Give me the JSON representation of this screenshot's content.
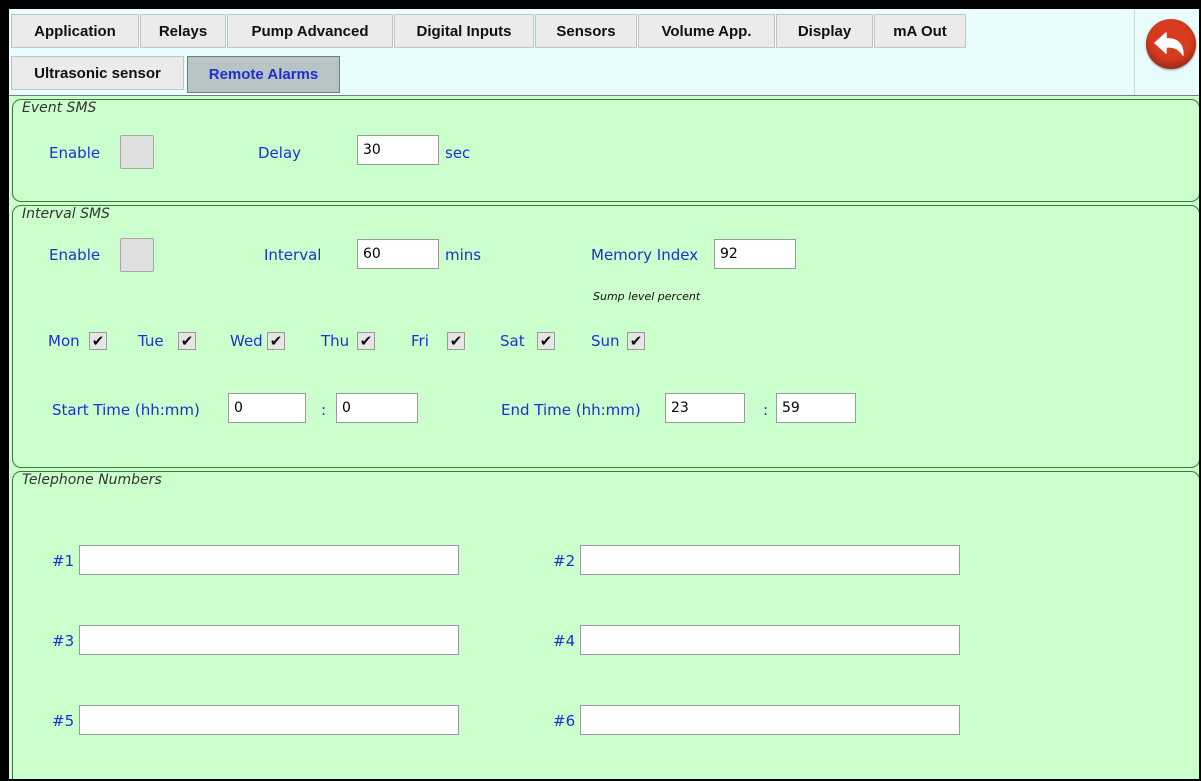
{
  "tabs": {
    "row1": [
      "Application",
      "Relays",
      "Pump Advanced",
      "Digital Inputs",
      "Sensors",
      "Volume App.",
      "Display",
      "mA Out"
    ],
    "row2": [
      "Ultrasonic sensor",
      "Remote Alarms"
    ],
    "active": "Remote Alarms"
  },
  "back_button": {
    "icon": "back-arrow-icon",
    "color": "#d63a1f"
  },
  "event_sms": {
    "title": "Event SMS",
    "enable_label": "Enable",
    "enable_checked": false,
    "delay_label": "Delay",
    "delay_value": "30",
    "delay_unit": "sec"
  },
  "interval_sms": {
    "title": "Interval SMS",
    "enable_label": "Enable",
    "enable_checked": false,
    "interval_label": "Interval",
    "interval_value": "60",
    "interval_unit": "mins",
    "memory_index_label": "Memory Index",
    "memory_index_value": "92",
    "memory_index_note": "Sump level percent",
    "days": [
      {
        "label": "Mon",
        "checked": true
      },
      {
        "label": "Tue",
        "checked": true
      },
      {
        "label": "Wed",
        "checked": true
      },
      {
        "label": "Thu",
        "checked": true
      },
      {
        "label": "Fri",
        "checked": true
      },
      {
        "label": "Sat",
        "checked": true
      },
      {
        "label": "Sun",
        "checked": true
      }
    ],
    "check_glyph": "✔",
    "start_time_label": "Start Time (hh:mm)",
    "start_hh": "0",
    "start_mm": "0",
    "end_time_label": "End Time (hh:mm)",
    "end_hh": "23",
    "end_mm": "59",
    "time_separator": ":"
  },
  "telephone": {
    "title": "Telephone Numbers",
    "numbers": [
      {
        "label": "#1",
        "value": ""
      },
      {
        "label": "#2",
        "value": ""
      },
      {
        "label": "#3",
        "value": ""
      },
      {
        "label": "#4",
        "value": ""
      },
      {
        "label": "#5",
        "value": ""
      },
      {
        "label": "#6",
        "value": ""
      }
    ]
  },
  "colors": {
    "panel_bg": "#cbffcb",
    "label_blue": "#1f2fd2",
    "header_bg": "#e8fdfd",
    "active_tab_bg": "#b9c5c5"
  }
}
